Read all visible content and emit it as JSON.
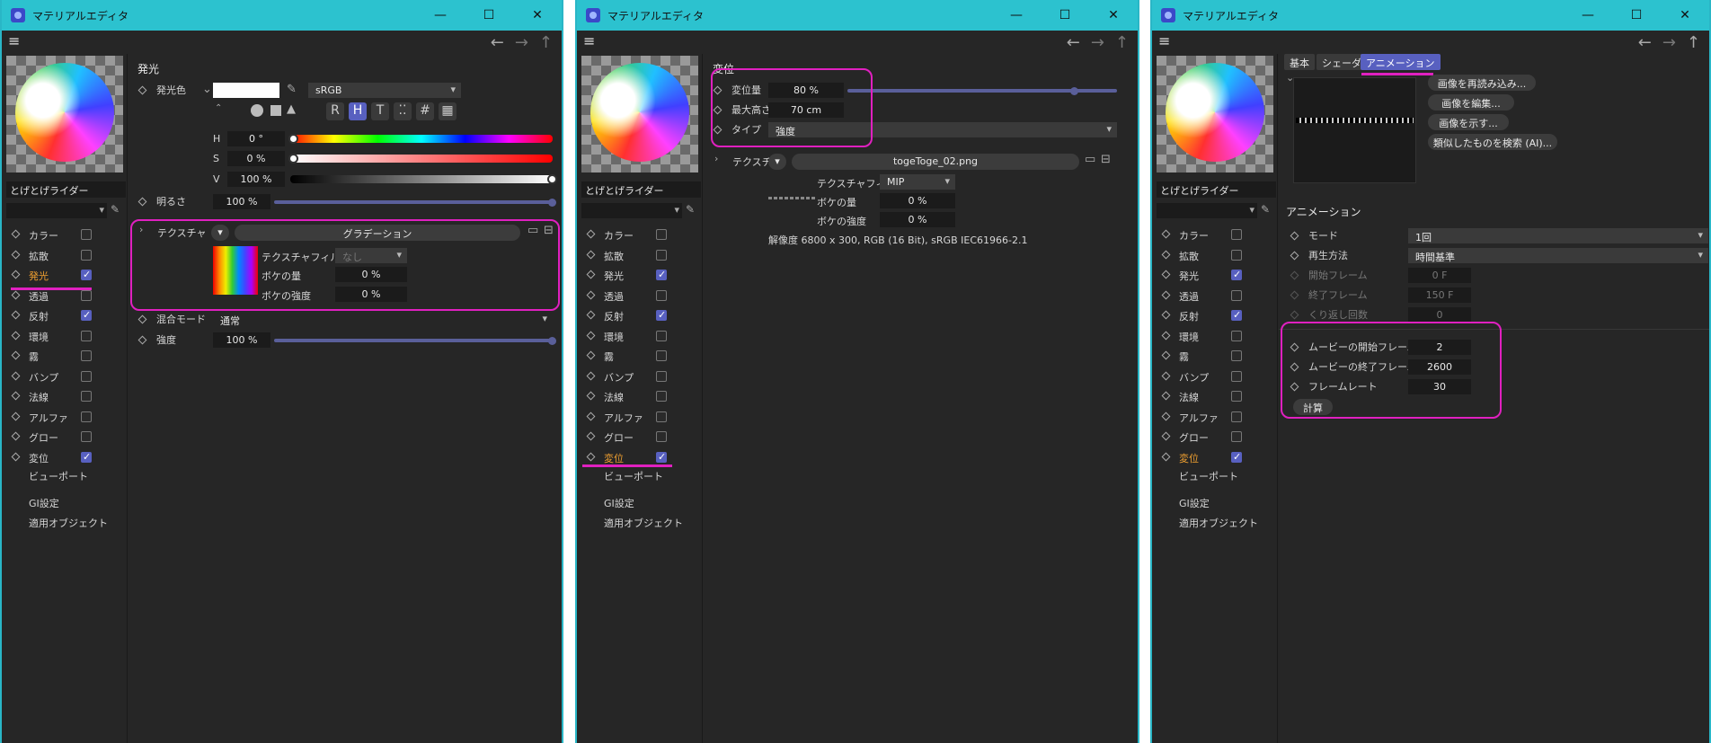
{
  "window_title": "マテリアルエディタ",
  "material_name": "とげとげライダー",
  "channels": [
    "カラー",
    "拡散",
    "発光",
    "透過",
    "反射",
    "環境",
    "霧",
    "バンプ",
    "法線",
    "アルファ",
    "グロー",
    "変位"
  ],
  "extra_items": [
    "ビューポート",
    "GI設定",
    "適用オブジェクト"
  ],
  "colors": {
    "accent": "#5860c0",
    "highlight": "#e020c0",
    "titlebar": "#2cc2cf",
    "active_channel": "#f0a030"
  },
  "win1": {
    "section": "発光",
    "emission_color_label": "発光色",
    "color_space": "sRGB",
    "mode_buttons": [
      "R",
      "H",
      "T",
      "⁚⁚",
      "#",
      "▦"
    ],
    "h_label": "H",
    "h_value": "0 °",
    "s_label": "S",
    "s_value": "0 %",
    "v_label": "V",
    "v_value": "100 %",
    "brightness_label": "明るさ",
    "brightness_value": "100 %",
    "texture_label": "テクスチャ",
    "texture_value": "グラデーション",
    "filter_label": "テクスチャフィルタ",
    "filter_value": "なし",
    "blur_label": "ボケの量",
    "blur_value": "0 %",
    "blur_strength_label": "ボケの強度",
    "blur_strength_value": "0 %",
    "mix_mode_label": "混合モード",
    "mix_mode_value": "通常",
    "strength_label": "強度",
    "strength_value": "100 %"
  },
  "win2": {
    "section": "変位",
    "amount_label": "変位量",
    "amount_value": "80 %",
    "max_height_label": "最大高さ",
    "max_height_value": "70 cm",
    "type_label": "タイプ",
    "type_value": "強度",
    "texture_label": "テクスチャ",
    "texture_value": "togeToge_02.png",
    "filter_label": "テクスチャフィルタ",
    "filter_value": "MIP",
    "blur_label": "ボケの量",
    "blur_value": "0 %",
    "blur_strength_label": "ボケの強度",
    "blur_strength_value": "0 %",
    "resolution": "解像度 6800 x 300, RGB (16 Bit), sRGB IEC61966-2.1"
  },
  "win3": {
    "tabs": [
      "基本",
      "シェーダ",
      "アニメーション"
    ],
    "image_buttons": [
      "画像を再読み込み...",
      "画像を編集...",
      "画像を示す...",
      "類似したものを検索 (AI)..."
    ],
    "section": "アニメーション",
    "mode_label": "モード",
    "mode_value": "1回",
    "playback_label": "再生方法",
    "playback_value": "時間基準",
    "start_frame_label": "開始フレーム",
    "start_frame_value": "0 F",
    "end_frame_label": "終了フレーム",
    "end_frame_value": "150 F",
    "loops_label": "くり返し回数",
    "loops_value": "0",
    "movie_start_label": "ムービーの開始フレーム",
    "movie_start_value": "2",
    "movie_end_label": "ムービーの終了フレーム",
    "movie_end_value": "2600",
    "frame_rate_label": "フレームレート",
    "frame_rate_value": "30",
    "calc_label": "計算"
  }
}
